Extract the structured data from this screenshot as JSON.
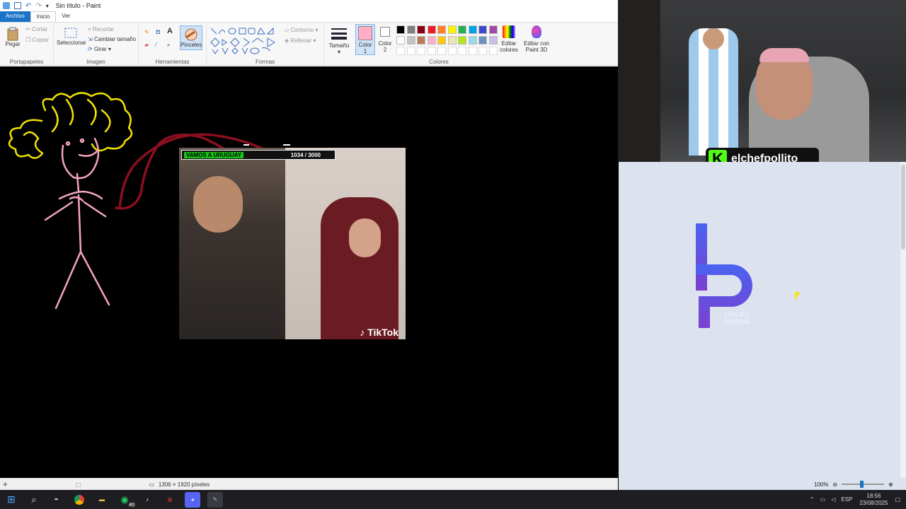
{
  "window": {
    "title": "Sin título - Paint"
  },
  "tabs": [
    {
      "label": "Archivo"
    },
    {
      "label": "Inicio"
    },
    {
      "label": "Ver"
    }
  ],
  "ribbon": {
    "clipboard": {
      "paste": "Pegar",
      "cut": "Cortar",
      "copy": "Copiar",
      "group": "Portapapeles"
    },
    "image": {
      "select": "Seleccionar",
      "crop": "Recortar",
      "resize": "Cambiar tamaño",
      "rotate": "Girar",
      "group": "Imagen"
    },
    "tools": {
      "group": "Herramientas",
      "brushes": "Pinceles"
    },
    "shapes": {
      "outline": "Contorno",
      "fill": "Rellenar",
      "group": "Formas"
    },
    "size": {
      "label": "Tamaño"
    },
    "color1": {
      "label": "Color",
      "num": "1"
    },
    "color2": {
      "label": "Color",
      "num": "2"
    },
    "colors": {
      "group": "Colores",
      "edit_l1": "Editar",
      "edit_l2": "colores",
      "paint3d_l1": "Editar con",
      "paint3d_l2": "Paint 3D"
    }
  },
  "palette": [
    "#000000",
    "#7f7f7f",
    "#880015",
    "#ed1c24",
    "#ff7f27",
    "#fff200",
    "#22b14c",
    "#00a2e8",
    "#3f48cc",
    "#a349a4",
    "#ffffff",
    "#c3c3c3",
    "#b97a57",
    "#ffaec9",
    "#ffc90e",
    "#efe4b0",
    "#b5e61d",
    "#99d9ea",
    "#7092be",
    "#c8bfe7"
  ],
  "video": {
    "banner_left": "VAMOS A URUGUAY",
    "banner_right": "1034 / 3000",
    "brand": "TikTok"
  },
  "status": {
    "dimensions": "1306 × 1920 píxeles",
    "zoom": "100%"
  },
  "stream": {
    "handle": "elchefpollito"
  },
  "sponsor": {
    "name_l1": "LUCKY",
    "name_l2": "PHONE"
  },
  "taskbar": {
    "lang": "ESP",
    "time": "18:56",
    "date": "23/08/2025",
    "badge": "40"
  }
}
